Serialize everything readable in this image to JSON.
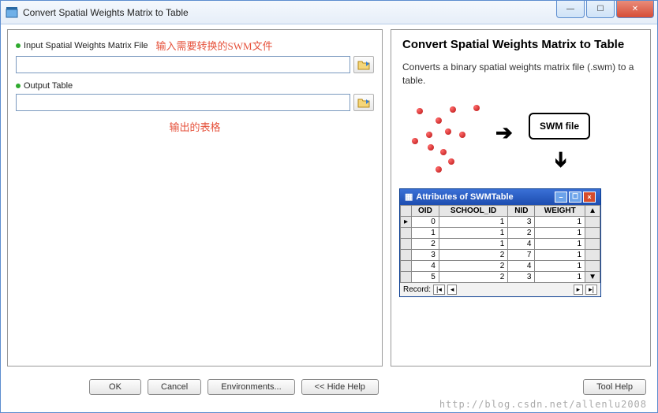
{
  "window": {
    "title": "Convert Spatial Weights Matrix to Table"
  },
  "params": {
    "input_label": "Input Spatial Weights Matrix File",
    "input_annot": "输入需要转换的SWM文件",
    "input_value": "",
    "output_label": "Output Table",
    "output_value": "",
    "output_annot": "输出的表格"
  },
  "help": {
    "title": "Convert Spatial Weights Matrix to Table",
    "desc": "Converts a binary spatial weights matrix file (.swm) to a table.",
    "swm_box": "SWM file",
    "attr_title": "Attributes of SWMTable",
    "cols": [
      "OID",
      "SCHOOL_ID",
      "NID",
      "WEIGHT"
    ],
    "rows": [
      {
        "oid": "0",
        "school": "1",
        "nid": "3",
        "w": "1"
      },
      {
        "oid": "1",
        "school": "1",
        "nid": "2",
        "w": "1"
      },
      {
        "oid": "2",
        "school": "1",
        "nid": "4",
        "w": "1"
      },
      {
        "oid": "3",
        "school": "2",
        "nid": "7",
        "w": "1"
      },
      {
        "oid": "4",
        "school": "2",
        "nid": "4",
        "w": "1"
      },
      {
        "oid": "5",
        "school": "2",
        "nid": "3",
        "w": "1"
      }
    ],
    "record_lbl": "Record:"
  },
  "buttons": {
    "ok": "OK",
    "cancel": "Cancel",
    "env": "Environments...",
    "hide": "<< Hide Help",
    "toolhelp": "Tool Help"
  },
  "watermark": "http://blog.csdn.net/allenlu2008"
}
